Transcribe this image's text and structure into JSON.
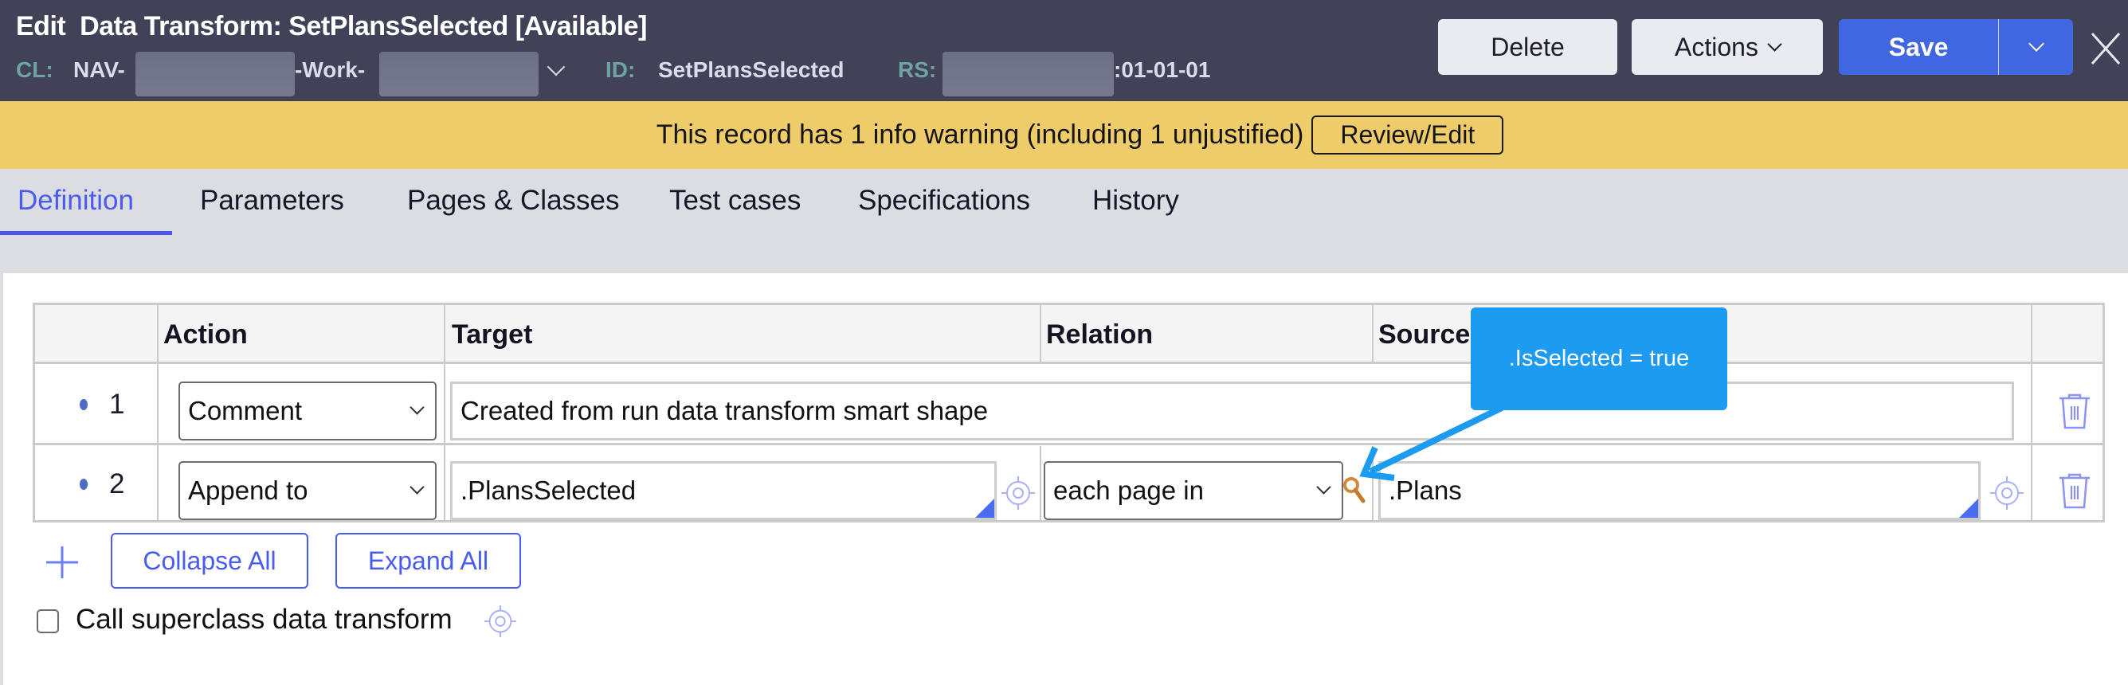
{
  "header": {
    "title_prefix": "Edit",
    "title": "Data Transform: SetPlansSelected",
    "status": "[Available]",
    "cl_label": "CL:",
    "cl_part1": "NAV-",
    "cl_part2": "-Work-",
    "id_label": "ID:",
    "id_value": "SetPlansSelected",
    "rs_label": "RS:",
    "rs_suffix": ":01-01-01",
    "buttons": {
      "delete": "Delete",
      "actions": "Actions",
      "save": "Save"
    }
  },
  "banner": {
    "text": "This record has 1 info warning (including 1 unjustified)",
    "button": "Review/Edit"
  },
  "tabs": [
    {
      "label": "Definition",
      "active": true
    },
    {
      "label": "Parameters"
    },
    {
      "label": "Pages & Classes"
    },
    {
      "label": "Test cases"
    },
    {
      "label": "Specifications"
    },
    {
      "label": "History"
    }
  ],
  "grid": {
    "columns": [
      "Action",
      "Target",
      "Relation",
      "Source"
    ],
    "rows": [
      {
        "num": "1",
        "action": "Comment",
        "target": "Created from run data transform smart shape"
      },
      {
        "num": "2",
        "action": "Append to",
        "target": ".PlansSelected",
        "relation": "each page in",
        "source": ".Plans"
      }
    ]
  },
  "tooltip": {
    "text": ".IsSelected = true"
  },
  "actions": {
    "collapse_all": "Collapse All",
    "expand_all": "Expand All"
  },
  "superclass": {
    "label": "Call superclass data transform",
    "checked": false
  },
  "colors": {
    "header_bg": "#414257",
    "banner_bg": "#efcc6a",
    "accent": "#4a5cf0",
    "save_blue": "#4067e0",
    "tooltip_blue": "#1d9bf0"
  }
}
